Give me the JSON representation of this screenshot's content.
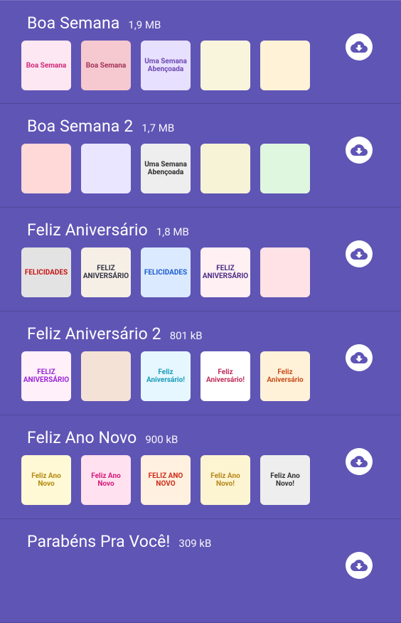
{
  "packs": [
    {
      "name": "Boa Semana",
      "size": "1,9 MB",
      "stickers": [
        {
          "text": "Boa Semana",
          "bg": "#fde7f2",
          "fg": "#d22a7a"
        },
        {
          "text": "Boa Semana",
          "bg": "#f6c8cf",
          "fg": "#a3345b"
        },
        {
          "text": "Uma Semana Abençoada",
          "bg": "#e8e0ff",
          "fg": "#6c4ab1"
        },
        {
          "text": "",
          "bg": "#f9f5dd",
          "fg": "#a06a14"
        },
        {
          "text": "",
          "bg": "#fff2d6",
          "fg": "#2c4aa8"
        }
      ]
    },
    {
      "name": "Boa Semana 2",
      "size": "1,7 MB",
      "stickers": [
        {
          "text": "",
          "bg": "#ffd8d8",
          "fg": "#cc2244"
        },
        {
          "text": "",
          "bg": "#eae6ff",
          "fg": "#5a3bc7"
        },
        {
          "text": "Uma Semana Abençoada",
          "bg": "#eeeeee",
          "fg": "#2d2d2d"
        },
        {
          "text": "",
          "bg": "#f7f3d6",
          "fg": "#7a6a2a"
        },
        {
          "text": "",
          "bg": "#dff7df",
          "fg": "#1a8a2a"
        }
      ]
    },
    {
      "name": "Feliz Aniversário",
      "size": "1,8 MB",
      "stickers": [
        {
          "text": "FELICIDADES",
          "bg": "#e3e3e3",
          "fg": "#c61515"
        },
        {
          "text": "FELIZ ANIVERSÁRIO",
          "bg": "#f6efe6",
          "fg": "#334"
        },
        {
          "text": "FELICIDADES",
          "bg": "#dceaff",
          "fg": "#1b5dd2"
        },
        {
          "text": "FELIZ ANIVERSÁRIO",
          "bg": "#fff0f3",
          "fg": "#4a2b86"
        },
        {
          "text": "",
          "bg": "#ffe2e6",
          "fg": "#c41b1b"
        }
      ]
    },
    {
      "name": "Feliz Aniversário 2",
      "size": "801 kB",
      "stickers": [
        {
          "text": "FELIZ ANIVERSÁRIO",
          "bg": "#fff0fa",
          "fg": "#9a24d6"
        },
        {
          "text": "",
          "bg": "#f5e2d6",
          "fg": "#a75b26"
        },
        {
          "text": "Feliz Aniversário!",
          "bg": "#e6f7ff",
          "fg": "#199bb9"
        },
        {
          "text": "Feliz Aniversário!",
          "bg": "#ffffff",
          "fg": "#c12a5a"
        },
        {
          "text": "Feliz Aniversário",
          "bg": "#fff2d9",
          "fg": "#c84d1b"
        }
      ]
    },
    {
      "name": "Feliz Ano Novo",
      "size": "900 kB",
      "stickers": [
        {
          "text": "Feliz Ano Novo",
          "bg": "#fff9d5",
          "fg": "#b38a10"
        },
        {
          "text": "Feliz Ano Novo",
          "bg": "#ffe1ef",
          "fg": "#d51a7a"
        },
        {
          "text": "FELIZ ANO NOVO",
          "bg": "#fff0e0",
          "fg": "#ce2d18"
        },
        {
          "text": "Feliz Ano Novo!",
          "bg": "#fdf5d1",
          "fg": "#b6861a"
        },
        {
          "text": "Feliz Ano Novo!",
          "bg": "#eeeeee",
          "fg": "#333333"
        }
      ]
    },
    {
      "name": "Parabéns Pra Você!",
      "size": "309 kB",
      "stickers": []
    }
  ]
}
